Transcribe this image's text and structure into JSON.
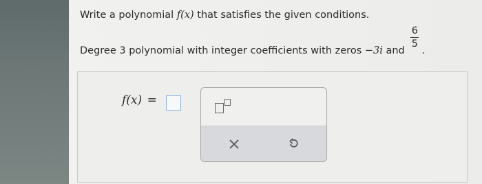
{
  "question": {
    "line1_prefix": "Write a polynomial",
    "line1_fx": "f(x)",
    "line1_suffix": "that satisfies the given conditions.",
    "line2_text": "Degree 3 polynomial with integer coefficients with zeros",
    "zero1": "−3i",
    "and": "and",
    "frac_num": "6",
    "frac_den": "5",
    "period": "."
  },
  "answer": {
    "label": "f(x)",
    "equals": "=",
    "input_value": ""
  },
  "toolbox": {
    "exponent_icon": "exponent-template-icon",
    "clear_icon": "x-icon",
    "undo_icon": "undo-icon"
  }
}
